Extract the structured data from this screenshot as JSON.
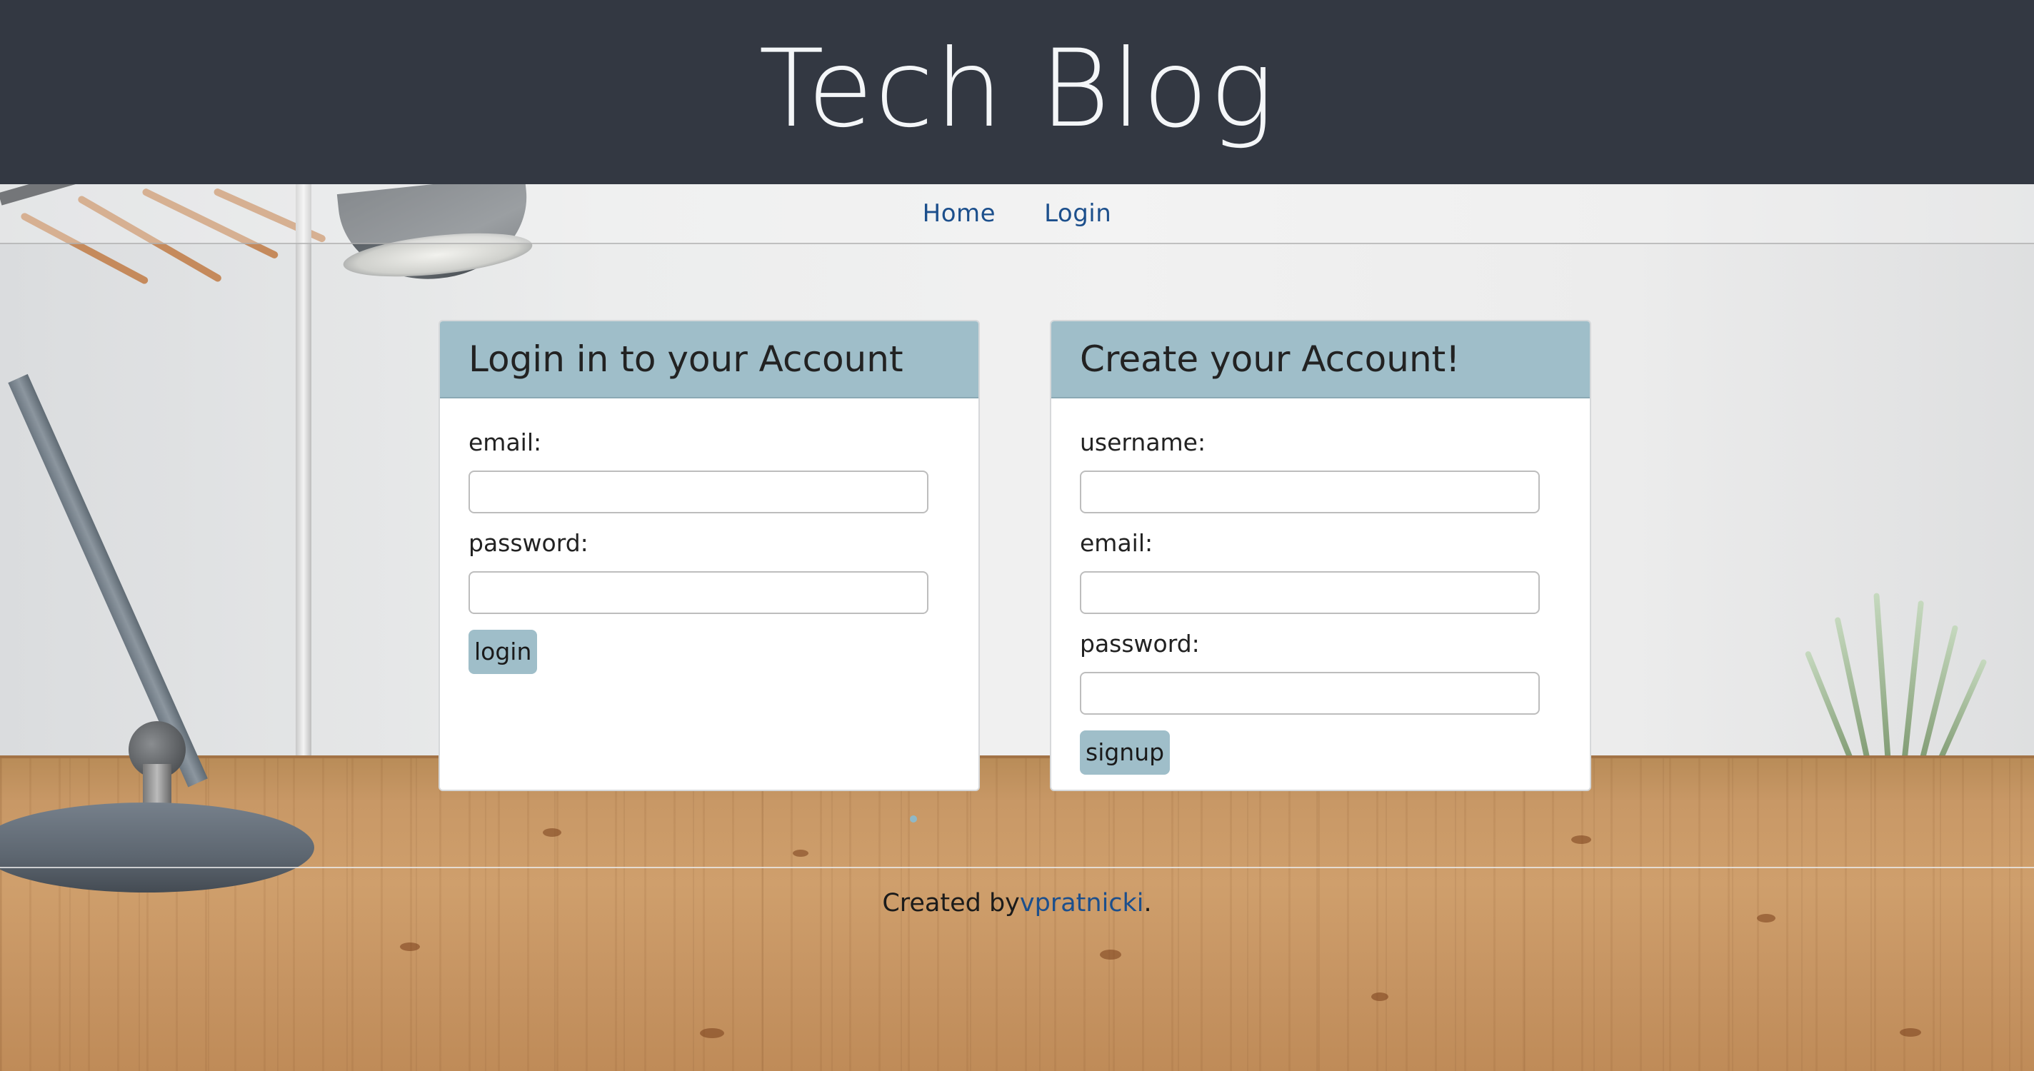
{
  "header": {
    "title": "Tech Blog"
  },
  "nav": {
    "items": [
      {
        "label": "Home"
      },
      {
        "label": "Login"
      }
    ]
  },
  "login_card": {
    "title": "Login in to your Account",
    "email_label": "email:",
    "email_value": "",
    "password_label": "password:",
    "password_value": "",
    "button_label": "login"
  },
  "signup_card": {
    "title": "Create your Account!",
    "username_label": "username:",
    "username_value": "",
    "email_label": "email:",
    "email_value": "",
    "password_label": "password:",
    "password_value": "",
    "button_label": "signup"
  },
  "footer": {
    "prefix": "Created by",
    "author": "vpratnicki",
    "suffix": "."
  },
  "colors": {
    "header_bg": "#333842",
    "card_header_bg": "#9fbec9",
    "button_bg": "#9fbec9",
    "link": "#1c4f8c"
  }
}
